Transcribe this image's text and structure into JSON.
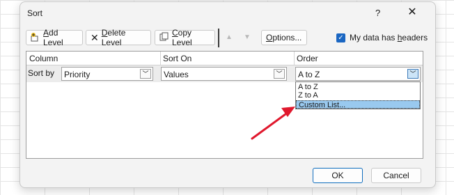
{
  "dialog": {
    "title": "Sort",
    "help_label": "?",
    "close_label": "✕"
  },
  "toolbar": {
    "add_level_pre": "",
    "add_level_accel": "A",
    "add_level_rest": "dd Level",
    "delete_level_pre": "",
    "delete_level_accel": "D",
    "delete_level_rest": "elete Level",
    "copy_level_pre": "",
    "copy_level_accel": "C",
    "copy_level_rest": "opy Level",
    "move_up_icon": "triangle-up",
    "move_down_icon": "triangle-down",
    "options_pre": "",
    "options_accel": "O",
    "options_rest": "ptions...",
    "headers_checked": true,
    "headers_label_pre": "My data has ",
    "headers_label_accel": "h",
    "headers_label_rest": "eaders"
  },
  "grid": {
    "headers": [
      "Column",
      "Sort On",
      "Order"
    ],
    "rows": [
      {
        "label": "Sort by",
        "column": "Priority",
        "sort_on": "Values",
        "order": "A to Z"
      }
    ]
  },
  "order_dropdown": {
    "options": [
      "A to Z",
      "Z to A",
      "Custom List..."
    ],
    "highlighted": "Custom List..."
  },
  "footer": {
    "ok_label": "OK",
    "cancel_label": "Cancel"
  },
  "colors": {
    "accent": "#1a66c2",
    "highlight": "#99c9ef",
    "annotation_arrow": "#e0182d"
  }
}
